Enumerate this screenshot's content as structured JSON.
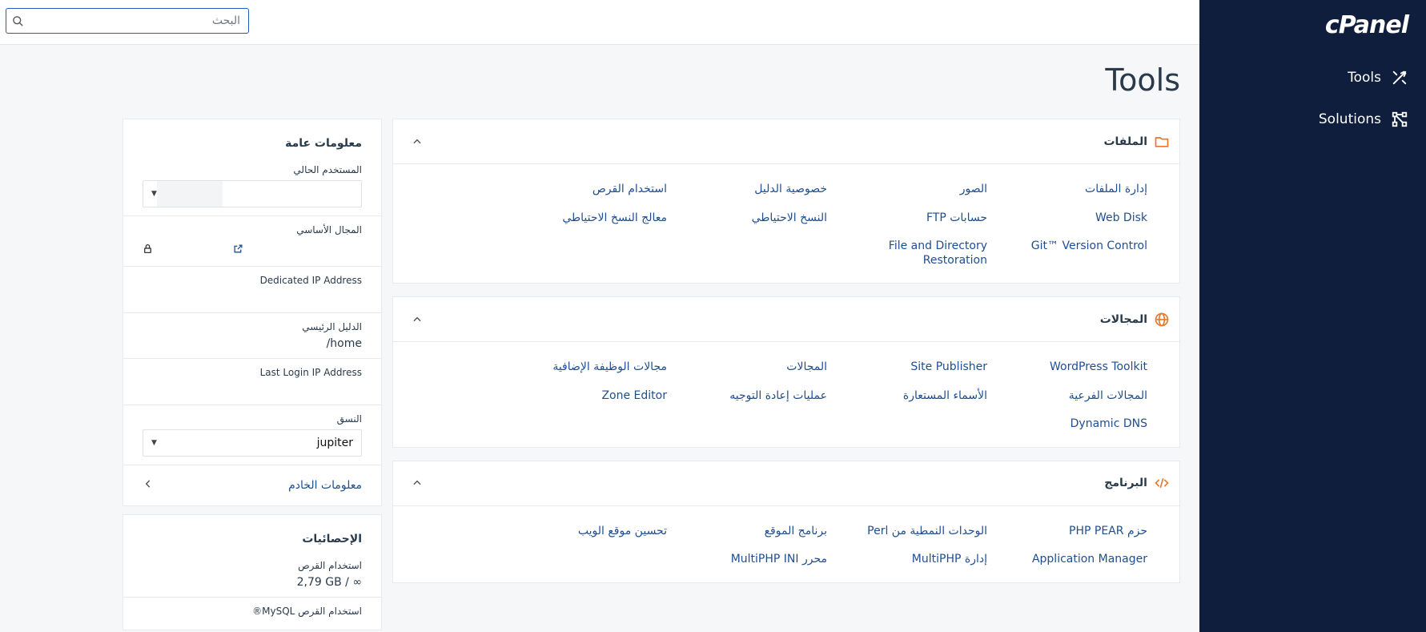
{
  "sidebar": {
    "logo": "cPanel",
    "items": [
      {
        "label": "Tools"
      },
      {
        "label": "Solutions"
      }
    ]
  },
  "search": {
    "placeholder": "البحث",
    "value": ""
  },
  "page_title": "Tools",
  "panels": {
    "files": {
      "title": "الملفات",
      "links": [
        "إدارة الملفات",
        "الصور",
        "خصوصية الدليل",
        "استخدام القرص",
        "Web Disk",
        "حسابات FTP",
        "النسخ الاحتياطي",
        "معالج النسخ الاحتياطي",
        "Git™ Version Control",
        "File and Directory Restoration"
      ]
    },
    "domains": {
      "title": "المجالات",
      "links": [
        "WordPress Toolkit",
        "Site Publisher",
        "المجالات",
        "مجالات الوظيفة الإضافية",
        "المجالات الفرعية",
        "الأسماء المستعارة",
        "عمليات إعادة التوجيه",
        "Zone Editor",
        "Dynamic DNS"
      ]
    },
    "software": {
      "title": "البرنامج",
      "links": [
        "حزم PHP PEAR",
        "الوحدات النمطية من Perl",
        "برنامج الموقع",
        "تحسين موقع الويب",
        "Application Manager",
        "إدارة MultiPHP",
        "محرر MultiPHP INI"
      ]
    }
  },
  "general_info": {
    "title": "معلومات عامة",
    "current_user_label": "المستخدم الحالي",
    "current_user_value": "",
    "primary_domain_label": "المجال الأساسي",
    "dedicated_ip_label": "Dedicated IP Address",
    "home_dir_label": "الدليل الرئيسي",
    "home_dir_value": "/home",
    "last_login_label": "Last Login IP Address",
    "theme_label": "النسق",
    "theme_value": "jupiter",
    "server_info_label": "معلومات الخادم"
  },
  "statistics": {
    "title": "الإحصائيات",
    "disk_usage_label": "استخدام القرص",
    "disk_usage_value": "2,79 GB / ∞",
    "mysql_label": "استخدام القرص MySQL®"
  },
  "colors": {
    "sidebar_bg": "#0f1e3c",
    "accent_orange": "#e8792b",
    "link_blue": "#1f4e90"
  }
}
